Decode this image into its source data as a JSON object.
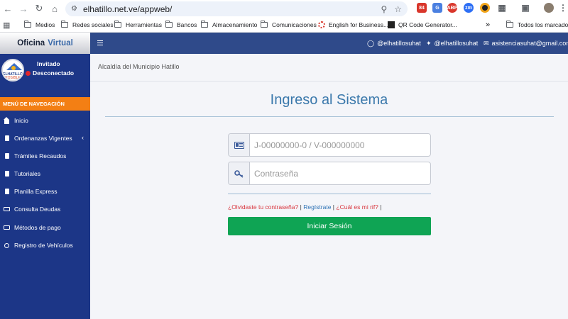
{
  "browser": {
    "url": "elhatillo.net.ve/appweb/",
    "extensions": [
      {
        "name": "calendar-ext",
        "badge": "84",
        "color": "#d9362b"
      },
      {
        "name": "translate-ext",
        "color": "#4a7fe0"
      },
      {
        "name": "adblock-ext",
        "badge": "ABP",
        "color": "#d9362b"
      },
      {
        "name": "zoom-ext",
        "badge": "zm",
        "color": "#2d6ff5"
      },
      {
        "name": "color-ext",
        "color": "#f2a51a"
      }
    ],
    "bookmarks": [
      {
        "label": "Medios"
      },
      {
        "label": "Redes sociales"
      },
      {
        "label": "Herramientas"
      },
      {
        "label": "Bancos"
      },
      {
        "label": "Almacenamiento"
      },
      {
        "label": "Comunicaciones"
      },
      {
        "label": "English for Business..."
      },
      {
        "label": "QR Code Generator..."
      },
      {
        "label": "Todos los marcadores"
      }
    ]
  },
  "header": {
    "brand_part1": "Oficina",
    "brand_part2": "Virtual",
    "instagram": "@elhatillosuhat",
    "twitter": "@elhatillosuhat",
    "email": "asistenciasuhat@gmail.com"
  },
  "sidebar": {
    "logo_text1": "ELHATILLO",
    "logo_text2": "POSIBLE",
    "user_name": "Invitado",
    "status": "Desconectado",
    "nav_header": "MENÚ DE NAVEGACIÓN",
    "items": [
      {
        "label": "Inicio",
        "icon": "home-icon"
      },
      {
        "label": "Ordenanzas Vigentes",
        "icon": "file-icon",
        "chevron": "‹"
      },
      {
        "label": "Trámites Recaudos",
        "icon": "file-icon"
      },
      {
        "label": "Tutoriales",
        "icon": "file-icon"
      },
      {
        "label": "Planilla Express",
        "icon": "file-icon"
      },
      {
        "label": "Consulta Deudas",
        "icon": "card-icon"
      },
      {
        "label": "Métodos de pago",
        "icon": "card-icon"
      },
      {
        "label": "Registro de Vehículos",
        "icon": "circle-icon"
      }
    ]
  },
  "main": {
    "breadcrumb": "Alcaldía del Municipio Hatillo",
    "title": "Ingreso al Sistema",
    "id_placeholder": "J-00000000-0 / V-000000000",
    "password_placeholder": "Contraseña",
    "forgot_link": "¿Olvidaste tu contraseña?",
    "register_link": "Regístrate",
    "rif_link": "¿Cuál es mi rif?",
    "separator": "|",
    "login_button": "Iniciar Sesión"
  }
}
